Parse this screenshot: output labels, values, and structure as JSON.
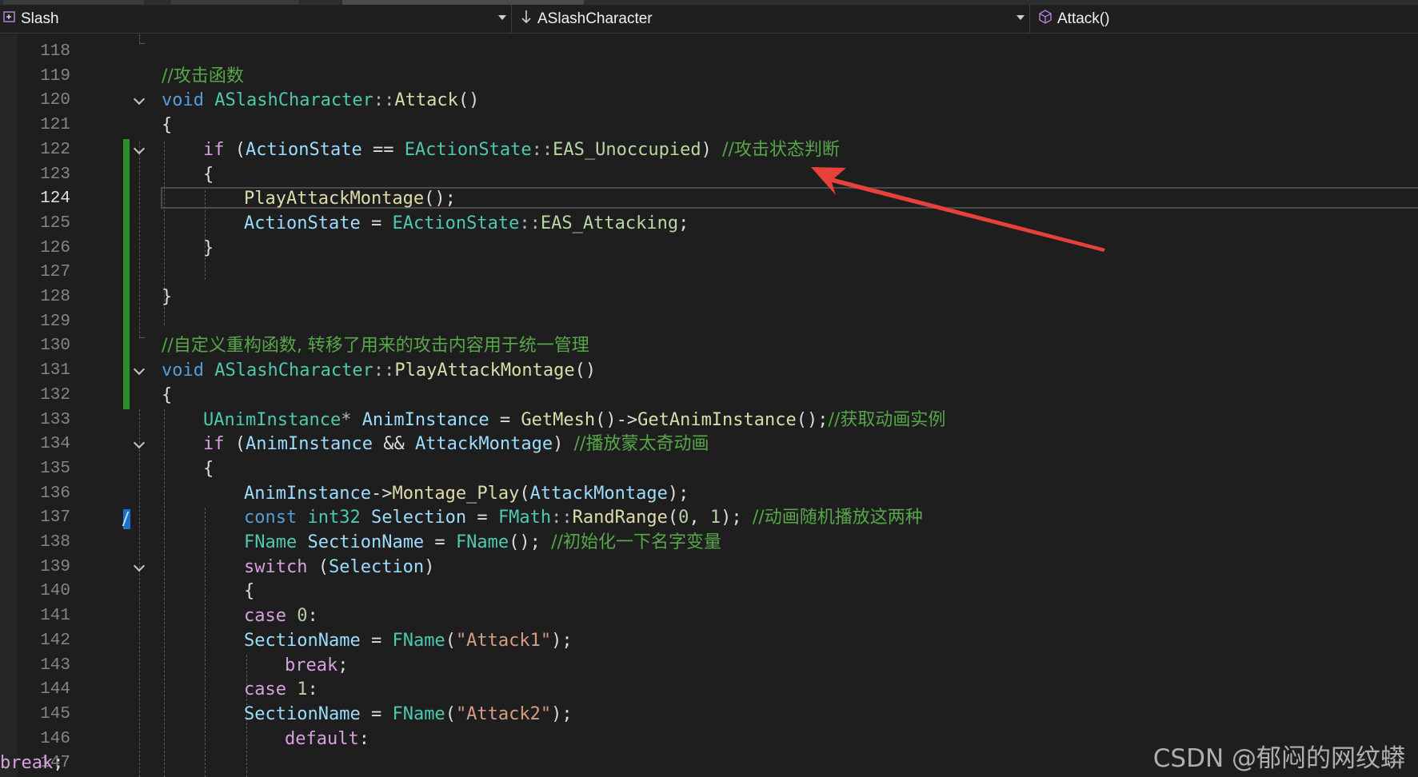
{
  "navbar": {
    "project": "Slash",
    "class_scope": "ASlashCharacter",
    "member": "Attack()"
  },
  "editor": {
    "lines": [
      {
        "n": "118",
        "parts": []
      },
      {
        "n": "119",
        "parts": [
          {
            "c": "cm",
            "t": "//攻击函数"
          }
        ]
      },
      {
        "n": "120",
        "parts": [
          {
            "c": "kw",
            "t": "void "
          },
          {
            "c": "ty",
            "t": "ASlashCharacter"
          },
          {
            "c": "op",
            "t": "::"
          },
          {
            "c": "fn",
            "t": "Attack"
          },
          {
            "c": "lo",
            "t": "()"
          }
        ]
      },
      {
        "n": "121",
        "parts": [
          {
            "c": "lo",
            "t": "{"
          }
        ]
      },
      {
        "n": "122",
        "parts": [
          {
            "c": "ctl",
            "t": "if "
          },
          {
            "c": "lo",
            "t": "("
          },
          {
            "c": "va",
            "t": "ActionState"
          },
          {
            "c": "lo",
            "t": " == "
          },
          {
            "c": "ty",
            "t": "EActionState"
          },
          {
            "c": "op",
            "t": "::"
          },
          {
            "c": "en",
            "t": "EAS_Unoccupied"
          },
          {
            "c": "lo",
            "t": ") "
          },
          {
            "c": "cm",
            "t": "//攻击状态判断"
          }
        ]
      },
      {
        "n": "123",
        "parts": [
          {
            "c": "lo",
            "t": "{"
          }
        ]
      },
      {
        "n": "124",
        "parts": [
          {
            "c": "fn",
            "t": "PlayAttackMontage"
          },
          {
            "c": "lo",
            "t": "();"
          }
        ]
      },
      {
        "n": "125",
        "parts": [
          {
            "c": "va",
            "t": "ActionState"
          },
          {
            "c": "lo",
            "t": " = "
          },
          {
            "c": "ty",
            "t": "EActionState"
          },
          {
            "c": "op",
            "t": "::"
          },
          {
            "c": "en",
            "t": "EAS_Attacking"
          },
          {
            "c": "lo",
            "t": ";"
          }
        ]
      },
      {
        "n": "126",
        "parts": [
          {
            "c": "lo",
            "t": "}"
          }
        ]
      },
      {
        "n": "127",
        "parts": []
      },
      {
        "n": "128",
        "parts": [
          {
            "c": "lo",
            "t": "}"
          }
        ]
      },
      {
        "n": "129",
        "parts": []
      },
      {
        "n": "130",
        "parts": [
          {
            "c": "cm",
            "t": "//自定义重构函数, 转移了用来的攻击内容用于统一管理"
          }
        ]
      },
      {
        "n": "131",
        "parts": [
          {
            "c": "kw",
            "t": "void "
          },
          {
            "c": "ty",
            "t": "ASlashCharacter"
          },
          {
            "c": "op",
            "t": "::"
          },
          {
            "c": "fn",
            "t": "PlayAttackMontage"
          },
          {
            "c": "lo",
            "t": "()"
          }
        ]
      },
      {
        "n": "132",
        "parts": [
          {
            "c": "lo",
            "t": "{"
          }
        ]
      },
      {
        "n": "133",
        "parts": [
          {
            "c": "ty",
            "t": "UAnimInstance"
          },
          {
            "c": "op",
            "t": "* "
          },
          {
            "c": "va",
            "t": "AnimInstance"
          },
          {
            "c": "lo",
            "t": " = "
          },
          {
            "c": "fn",
            "t": "GetMesh"
          },
          {
            "c": "lo",
            "t": "()->"
          },
          {
            "c": "fn",
            "t": "GetAnimInstance"
          },
          {
            "c": "lo",
            "t": "();"
          },
          {
            "c": "cm",
            "t": "//获取动画实例"
          }
        ]
      },
      {
        "n": "134",
        "parts": [
          {
            "c": "ctl",
            "t": "if "
          },
          {
            "c": "lo",
            "t": "("
          },
          {
            "c": "va",
            "t": "AnimInstance"
          },
          {
            "c": "lo",
            "t": " && "
          },
          {
            "c": "va",
            "t": "AttackMontage"
          },
          {
            "c": "lo",
            "t": ") "
          },
          {
            "c": "cm",
            "t": "//播放蒙太奇动画"
          }
        ]
      },
      {
        "n": "135",
        "parts": [
          {
            "c": "lo",
            "t": "{"
          }
        ]
      },
      {
        "n": "136",
        "parts": [
          {
            "c": "va",
            "t": "AnimInstance"
          },
          {
            "c": "lo",
            "t": "->"
          },
          {
            "c": "fn",
            "t": "Montage_Play"
          },
          {
            "c": "lo",
            "t": "("
          },
          {
            "c": "va",
            "t": "AttackMontage"
          },
          {
            "c": "lo",
            "t": ");"
          }
        ]
      },
      {
        "n": "137",
        "parts": [
          {
            "c": "kw",
            "t": "const "
          },
          {
            "c": "ty",
            "t": "int32 "
          },
          {
            "c": "va",
            "t": "Selection"
          },
          {
            "c": "lo",
            "t": " = "
          },
          {
            "c": "ty",
            "t": "FMath"
          },
          {
            "c": "op",
            "t": "::"
          },
          {
            "c": "fn",
            "t": "RandRange"
          },
          {
            "c": "lo",
            "t": "("
          },
          {
            "c": "nu",
            "t": "0"
          },
          {
            "c": "lo",
            "t": ", "
          },
          {
            "c": "nu",
            "t": "1"
          },
          {
            "c": "lo",
            "t": "); "
          },
          {
            "c": "cm",
            "t": "//动画随机播放这两种"
          }
        ]
      },
      {
        "n": "138",
        "parts": [
          {
            "c": "ty",
            "t": "FName "
          },
          {
            "c": "va",
            "t": "SectionName"
          },
          {
            "c": "lo",
            "t": " = "
          },
          {
            "c": "ty",
            "t": "FName"
          },
          {
            "c": "lo",
            "t": "(); "
          },
          {
            "c": "cm",
            "t": "//初始化一下名字变量"
          }
        ]
      },
      {
        "n": "139",
        "parts": [
          {
            "c": "sw",
            "t": "switch "
          },
          {
            "c": "lo",
            "t": "("
          },
          {
            "c": "va",
            "t": "Selection"
          },
          {
            "c": "lo",
            "t": ")"
          }
        ]
      },
      {
        "n": "140",
        "parts": [
          {
            "c": "lo",
            "t": "{"
          }
        ]
      },
      {
        "n": "141",
        "parts": [
          {
            "c": "sw",
            "t": "case "
          },
          {
            "c": "nu",
            "t": "0"
          },
          {
            "c": "lo",
            "t": ":"
          }
        ]
      },
      {
        "n": "142",
        "parts": [
          {
            "c": "va",
            "t": "SectionName"
          },
          {
            "c": "lo",
            "t": " = "
          },
          {
            "c": "ty",
            "t": "FName"
          },
          {
            "c": "lo",
            "t": "("
          },
          {
            "c": "st",
            "t": "\"Attack1\""
          },
          {
            "c": "lo",
            "t": ");"
          }
        ]
      },
      {
        "n": "143",
        "parts": [
          {
            "c": "sw",
            "t": "break"
          },
          {
            "c": "lo",
            "t": ";"
          }
        ]
      },
      {
        "n": "144",
        "parts": [
          {
            "c": "sw",
            "t": "case "
          },
          {
            "c": "nu",
            "t": "1"
          },
          {
            "c": "lo",
            "t": ":"
          }
        ]
      },
      {
        "n": "145",
        "parts": [
          {
            "c": "va",
            "t": "SectionName"
          },
          {
            "c": "lo",
            "t": " = "
          },
          {
            "c": "ty",
            "t": "FName"
          },
          {
            "c": "lo",
            "t": "("
          },
          {
            "c": "st",
            "t": "\"Attack2\""
          },
          {
            "c": "lo",
            "t": ");"
          }
        ]
      },
      {
        "n": "146",
        "parts": [
          {
            "c": "sw",
            "t": "default"
          },
          {
            "c": "lo",
            "t": ":"
          }
        ]
      },
      {
        "n": "147",
        "parts": [
          {
            "c": "sw",
            "t": "break"
          },
          {
            "c": "lo",
            "t": ";"
          }
        ]
      }
    ],
    "current_line": "124"
  },
  "watermark": "CSDN @郁闷的网纹蟒",
  "colors": {
    "background": "#1e1e1e",
    "keyword": "#569cd6",
    "type": "#4ec9b0",
    "function": "#dcdcaa",
    "variable": "#9cdcfe",
    "comment": "#57a64a",
    "control": "#d8a0df",
    "change_bar": "#2c8f2c",
    "arrow": "#e8413c"
  },
  "icons": {
    "project": "project-icon",
    "class_scope": "scope-arrow-icon",
    "member": "method-cube-icon"
  }
}
